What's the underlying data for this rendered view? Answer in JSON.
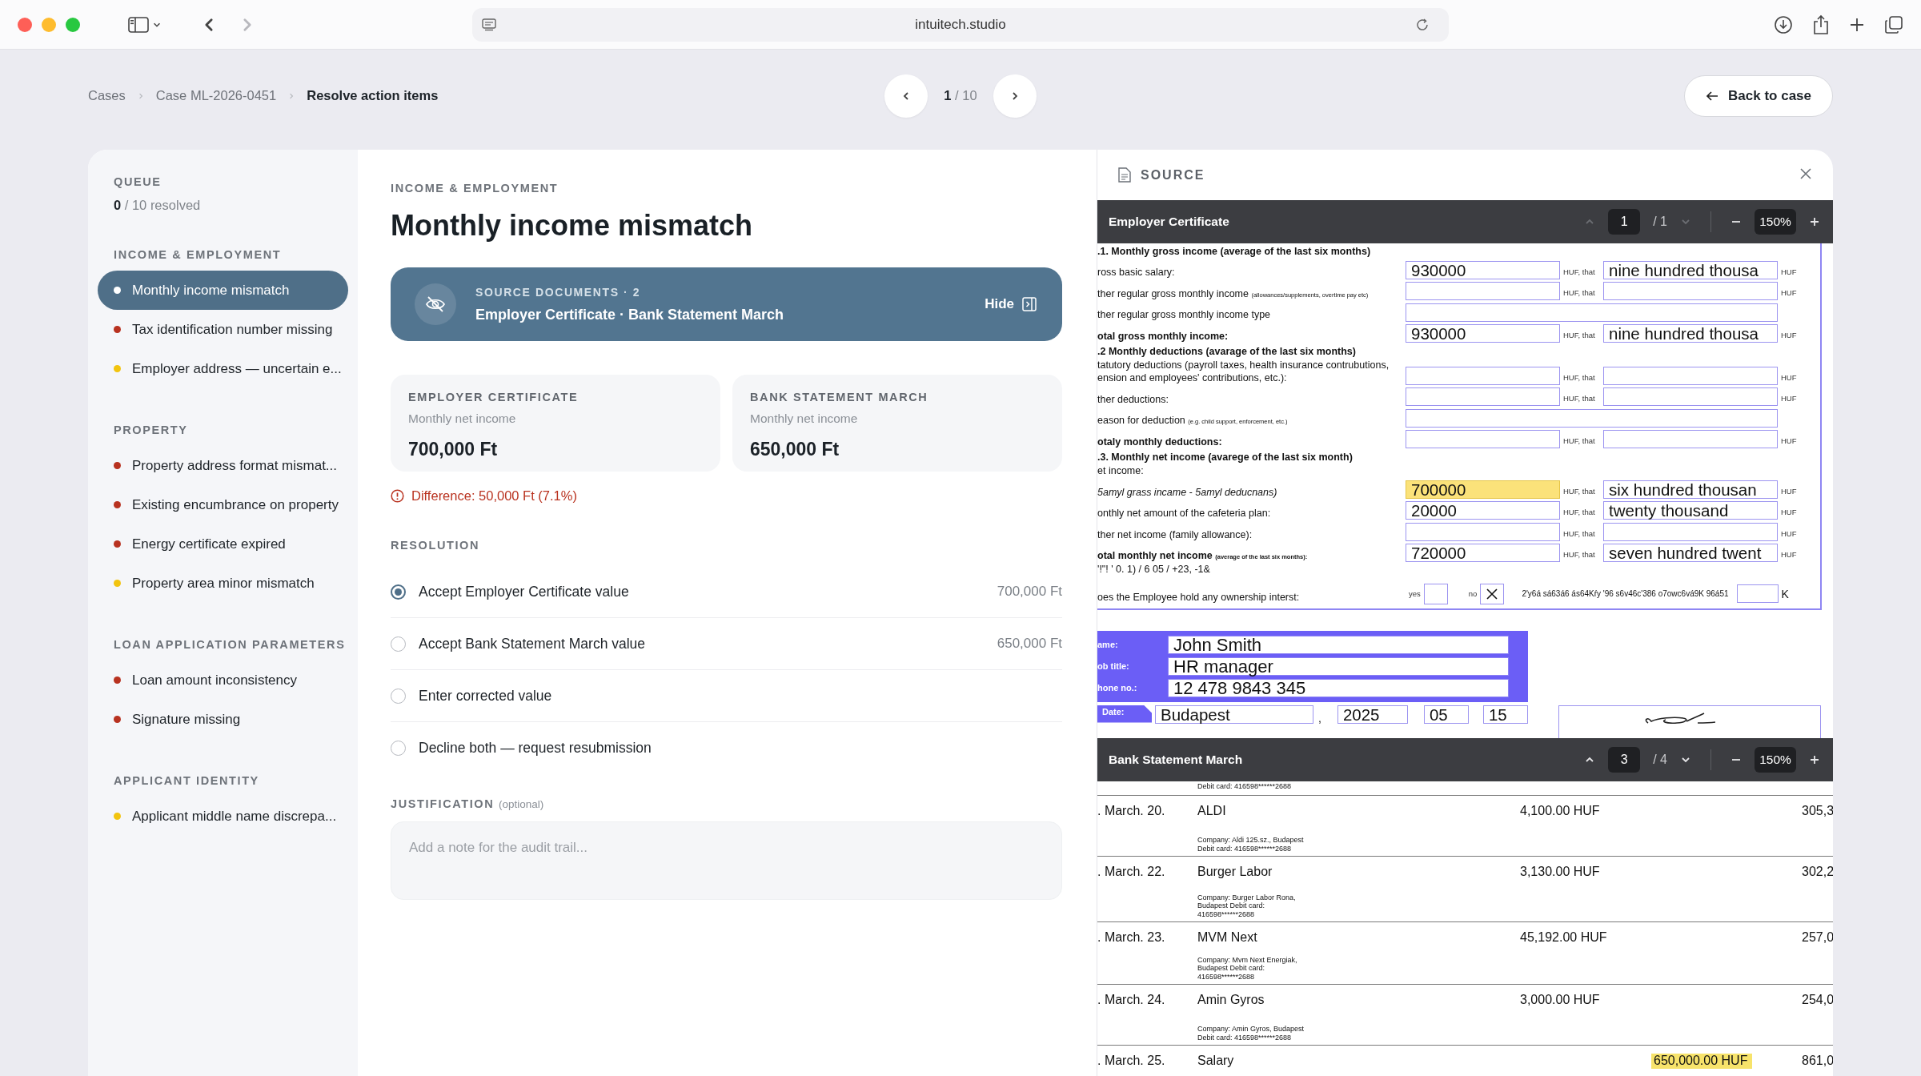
{
  "browser": {
    "url": "intuitech.studio"
  },
  "breadcrumb": [
    {
      "label": "Cases",
      "current": false
    },
    {
      "label": "Case ML-2026-0451",
      "current": false
    },
    {
      "label": "Resolve action items",
      "current": true
    }
  ],
  "pager": {
    "current": "1",
    "total": "/ 10"
  },
  "back_button": "Back to case",
  "sidebar": {
    "title": "QUEUE",
    "resolved": "**0** / 10 resolved",
    "groups": [
      {
        "title": "INCOME & EMPLOYMENT",
        "items": [
          {
            "label": "Monthly income mismatch",
            "selected": true
          },
          {
            "label": "Tax identification number missing",
            "color": "#b83220",
            "selected": false
          },
          {
            "label": "Employer address — uncertain e...",
            "color": "#f2c40f",
            "selected": false
          }
        ]
      },
      {
        "title": "PROPERTY",
        "items": [
          {
            "label": "Property address format mismat...",
            "color": "#b83220",
            "selected": false
          },
          {
            "label": "Existing encumbrance on property",
            "color": "#b83220",
            "selected": false
          },
          {
            "label": "Energy certificate expired",
            "color": "#b83220",
            "selected": false
          },
          {
            "label": "Property area minor mismatch",
            "color": "#f2c40f",
            "selected": false
          }
        ]
      },
      {
        "title": "LOAN APPLICATION PARAMETERS",
        "items": [
          {
            "label": "Loan amount inconsistency",
            "color": "#b83220",
            "selected": false
          },
          {
            "label": "Signature missing",
            "color": "#b83220",
            "selected": false
          }
        ]
      },
      {
        "title": "APPLICANT IDENTITY",
        "items": [
          {
            "label": "Applicant middle name discrepa...",
            "color": "#f2c40f",
            "selected": false
          }
        ]
      }
    ]
  },
  "issue": {
    "category": "INCOME & EMPLOYMENT",
    "title": "Monthly income mismatch",
    "sources": {
      "label": "SOURCE DOCUMENTS · 2",
      "names": "Employer Certificate · Bank Statement March",
      "hide": "Hide"
    },
    "values": [
      {
        "source": "EMPLOYER CERTIFICATE",
        "field": "Monthly net income",
        "value": "700,000 Ft"
      },
      {
        "source": "BANK STATEMENT MARCH",
        "field": "Monthly net income",
        "value": "650,000 Ft"
      }
    ],
    "difference": "Difference: 50,000 Ft (7.1%)",
    "resolution_title": "RESOLUTION",
    "options": [
      {
        "label": "Accept Employer Certificate value",
        "value": "700,000 Ft",
        "selected": true
      },
      {
        "label": "Accept Bank Statement March value",
        "value": "650,000 Ft",
        "selected": false
      },
      {
        "label": "Enter corrected value",
        "selected": false
      },
      {
        "label": "Decline both — request resubmission",
        "selected": false
      }
    ],
    "justification": {
      "label": "JUSTIFICATION",
      "hint": "(optional)",
      "placeholder": "Add a note for the audit trail..."
    }
  },
  "source_panel": {
    "title": "SOURCE",
    "documents": [
      {
        "kind": "form",
        "title": "Employer Certificate",
        "page": "1",
        "pages": "/ 1",
        "prev_disabled": true,
        "next_disabled": true,
        "zoom": "150%",
        "form": {
          "rows": [
            {
              "kind": "heading",
              "label": ".1.  Monthly gross income (average of the last six months)"
            },
            {
              "kind": "amount",
              "label": "ross basic salary:",
              "amount": "930000",
              "unit": "HUF, that",
              "words": "nine hundred thousa",
              "unit2": "HUF",
              "highlighted": false
            },
            {
              "kind": "amount",
              "label": "ther regular gross monthly income",
              "note": "(allowances/supplements, overtime pay etc)",
              "unit": "HUF, that",
              "unit2": "HUF",
              "highlighted": false
            },
            {
              "kind": "text",
              "label": "ther regular gross monthly income type"
            },
            {
              "kind": "total",
              "label": "otal gross monthly income:",
              "amount": "930000",
              "unit": "HUF, that",
              "words": "nine hundred thousa",
              "unit2": "HUF",
              "highlighted": false
            },
            {
              "kind": "heading",
              "label": ".2 Monthly deductions (avarage of the last six months)"
            },
            {
              "kind": "amount",
              "label": "tatutory deductions (payroll taxes, health insurance contrubutions,\nension and employees' contributions, etc.):",
              "unit": "HUF, that",
              "unit2": "HUF",
              "highlighted": false
            },
            {
              "kind": "amount",
              "label": "ther deductions:",
              "unit": "HUF, that",
              "unit2": "HUF",
              "highlighted": false
            },
            {
              "kind": "text",
              "label": "eason for deduction",
              "note": "(e.g. child support, enforcement, etc.)"
            },
            {
              "kind": "total",
              "label": "otaly monthly deductions:",
              "unit": "HUF, that",
              "unit2": "HUF",
              "highlighted": false
            },
            {
              "kind": "heading",
              "label": ".3. Monthly net income (avarege of the last six month)"
            },
            {
              "kind": "note",
              "label": "et income:"
            },
            {
              "kind": "formula",
              "label": "5amyl grass incame - 5amyl deducnans)",
              "amount": "700000",
              "unit": "HUF, that",
              "words": "six hundred thousan",
              "unit2": "HUF",
              "highlighted": true
            },
            {
              "kind": "amount",
              "label": "onthly net amount of the cafeteria plan:",
              "amount": "20000",
              "unit": "HUF, that",
              "words": "twenty thousand",
              "unit2": "HUF",
              "highlighted": false
            },
            {
              "kind": "amount",
              "label": "ther net income (family allowance):",
              "unit": "HUF, that",
              "unit2": "HUF",
              "highlighted": false
            },
            {
              "kind": "total",
              "label": "otal monthly net income",
              "note": "(average of the last six months):",
              "amount": "720000",
              "unit": "HUF, that",
              "words": "seven hundred twent",
              "unit2": "HUF",
              "highlighted": false
            },
            {
              "kind": "note",
              "label": "'!\"! ' 0.  1) / 6 05 / +23, -1&"
            },
            {
              "kind": "choice",
              "label": "oes the Employee hold any ownership interst:",
              "options": [
                {
                  "label": "yes",
                  "checked": false
                },
                {
                  "label": "no",
                  "checked": true
                }
              ],
              "garbled": "2'y6á  sá63á6  ás64Kŕy  '96  s6v46c'386  o7owc6vá9K  96á51",
              "unit": "K"
            }
          ]
        },
        "signatory": {
          "fields": [
            {
              "label": "ame:",
              "value": "John Smith"
            },
            {
              "label": "ob title:",
              "value": "HR manager"
            },
            {
              "label": "hone no.:",
              "value": "12 478 9843 345"
            }
          ],
          "date_label": "Date:",
          "place": "Budapest",
          "separator": ",",
          "year": "2025",
          "month": "05",
          "day": "15"
        }
      },
      {
        "kind": "statement",
        "title": "Bank Statement March",
        "page": "3",
        "pages": "/ 4",
        "prev_disabled": false,
        "next_disabled": false,
        "zoom": "150%",
        "lead": "Debit card: 416598******2688",
        "transactions": [
          {
            "date": ". March. 20.",
            "payee": "ALDI",
            "amount": "4,100.00 HUF",
            "balance": "305,3",
            "details": "Company: Aldi 125.sz., Budapest\nDebit card: 416598******2688",
            "highlighted": false
          },
          {
            "date": ". March. 22.",
            "payee": "Burger Labor",
            "amount": "3,130.00 HUF",
            "balance": "302,2",
            "details": "Company: Burger Labor Rona,\nBudapest   Debit card:\n416598******2688",
            "highlighted": false
          },
          {
            "date": ". March. 23.",
            "payee": "MVM Next",
            "amount": "45,192.00 HUF",
            "balance": "257,0",
            "details": "Company: Mvm Next Energiak,\nBudapest   Debit card:\n416598******2688",
            "highlighted": false
          },
          {
            "date": ". March. 24.",
            "payee": "Amin Gyros",
            "amount": "3,000.00 HUF",
            "balance": "254,0",
            "details": "Company: Amin Gyros, Budapest\nDebit card: 416598******2688",
            "highlighted": false
          },
          {
            "date": ". March. 25.",
            "payee": "Salary",
            "credit": "650,000.00 HUF",
            "balance": "861,0",
            "highlighted": true
          }
        ]
      }
    ]
  }
}
